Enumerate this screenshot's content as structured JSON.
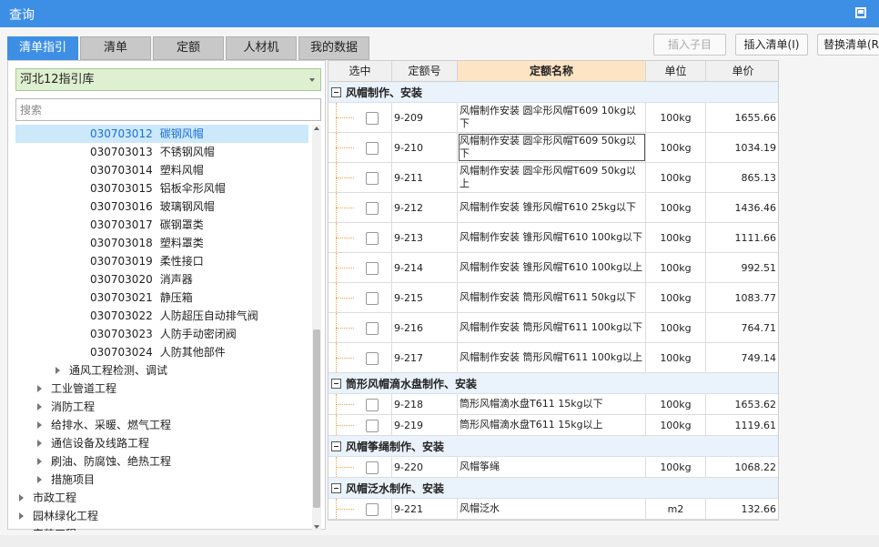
{
  "window": {
    "title": "查询"
  },
  "tabs": [
    {
      "label": "清单指引",
      "active": true
    },
    {
      "label": "清单"
    },
    {
      "label": "定额"
    },
    {
      "label": "人材机"
    },
    {
      "label": "我的数据"
    }
  ],
  "toolbar": {
    "insert_child": "插入子目",
    "insert_list": "插入清单(I)",
    "replace_list": "替换清单(R)"
  },
  "sidebar": {
    "library": "河北12指引库",
    "search_placeholder": "搜索",
    "tree": [
      {
        "code": "030703012",
        "label": "碳钢风帽",
        "level": 3,
        "selected": true
      },
      {
        "code": "030703013",
        "label": "不锈钢风帽",
        "level": 3
      },
      {
        "code": "030703014",
        "label": "塑料风帽",
        "level": 3
      },
      {
        "code": "030703015",
        "label": "铝板伞形风帽",
        "level": 3
      },
      {
        "code": "030703016",
        "label": "玻璃钢风帽",
        "level": 3
      },
      {
        "code": "030703017",
        "label": "碳钢罩类",
        "level": 3
      },
      {
        "code": "030703018",
        "label": "塑料罩类",
        "level": 3
      },
      {
        "code": "030703019",
        "label": "柔性接口",
        "level": 3
      },
      {
        "code": "030703020",
        "label": "消声器",
        "level": 3
      },
      {
        "code": "030703021",
        "label": "静压箱",
        "level": 3
      },
      {
        "code": "030703022",
        "label": "人防超压自动排气阀",
        "level": 3
      },
      {
        "code": "030703023",
        "label": "人防手动密闭阀",
        "level": 3
      },
      {
        "code": "030703024",
        "label": "人防其他部件",
        "level": 3
      },
      {
        "label": "通风工程检测、调试",
        "level": 2,
        "expandable": true
      },
      {
        "label": "工业管道工程",
        "level": 1,
        "expandable": true
      },
      {
        "label": "消防工程",
        "level": 1,
        "expandable": true
      },
      {
        "label": "给排水、采暖、燃气工程",
        "level": 1,
        "expandable": true
      },
      {
        "label": "通信设备及线路工程",
        "level": 1,
        "expandable": true
      },
      {
        "label": "刷油、防腐蚀、绝热工程",
        "level": 1,
        "expandable": true
      },
      {
        "label": "措施项目",
        "level": 1,
        "expandable": true
      },
      {
        "label": "市政工程",
        "level": 0,
        "expandable": true
      },
      {
        "label": "园林绿化工程",
        "level": 0,
        "expandable": true
      },
      {
        "label": "安装工程",
        "level": 0,
        "expandable": true
      }
    ]
  },
  "grid": {
    "columns": [
      "选中",
      "定额号",
      "定额名称",
      "单位",
      "单价"
    ],
    "groups": [
      {
        "title": "风帽制作、安装",
        "rows": [
          {
            "code": "9-209",
            "name": "风帽制作安装 圆伞形风帽T609 10kg以下",
            "unit": "100kg",
            "price": "1655.66"
          },
          {
            "code": "9-210",
            "name": "风帽制作安装 圆伞形风帽T609 50kg以下",
            "unit": "100kg",
            "price": "1034.19",
            "focused": true
          },
          {
            "code": "9-211",
            "name": "风帽制作安装 圆伞形风帽T609 50kg以上",
            "unit": "100kg",
            "price": "865.13"
          },
          {
            "code": "9-212",
            "name": "风帽制作安装 锥形风帽T610 25kg以下",
            "unit": "100kg",
            "price": "1436.46"
          },
          {
            "code": "9-213",
            "name": "风帽制作安装 锥形风帽T610 100kg以下",
            "unit": "100kg",
            "price": "1111.66"
          },
          {
            "code": "9-214",
            "name": "风帽制作安装 锥形风帽T610 100kg以上",
            "unit": "100kg",
            "price": "992.51"
          },
          {
            "code": "9-215",
            "name": "风帽制作安装 筒形风帽T611 50kg以下",
            "unit": "100kg",
            "price": "1083.77"
          },
          {
            "code": "9-216",
            "name": "风帽制作安装 筒形风帽T611 100kg以下",
            "unit": "100kg",
            "price": "764.71"
          },
          {
            "code": "9-217",
            "name": "风帽制作安装 筒形风帽T611 100kg以上",
            "unit": "100kg",
            "price": "749.14"
          }
        ]
      },
      {
        "title": "筒形风帽滴水盘制作、安装",
        "rows": [
          {
            "code": "9-218",
            "name": "筒形风帽滴水盘T611 15kg以下",
            "unit": "100kg",
            "price": "1653.62"
          },
          {
            "code": "9-219",
            "name": "筒形风帽滴水盘T611 15kg以上",
            "unit": "100kg",
            "price": "1119.61"
          }
        ]
      },
      {
        "title": "风帽筝绳制作、安装",
        "rows": [
          {
            "code": "9-220",
            "name": "风帽筝绳",
            "unit": "100kg",
            "price": "1068.22"
          }
        ]
      },
      {
        "title": "风帽泛水制作、安装",
        "rows": [
          {
            "code": "9-221",
            "name": "风帽泛水",
            "unit": "m2",
            "price": "132.66"
          }
        ]
      }
    ]
  }
}
